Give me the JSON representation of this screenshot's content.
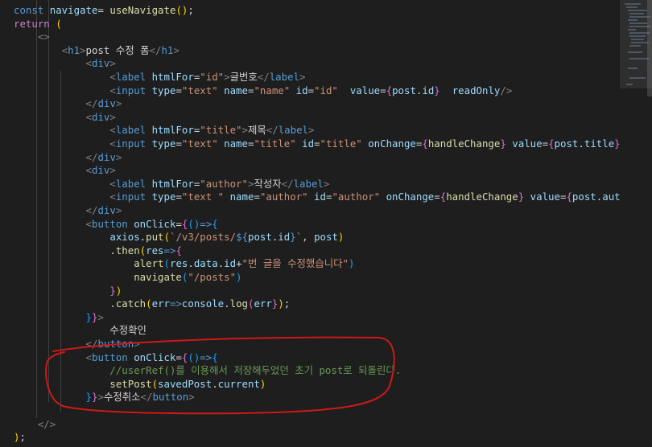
{
  "editor": {
    "language": "jsx",
    "lines": [
      [
        [
          "kw",
          "const "
        ],
        [
          "var",
          "navigate"
        ],
        [
          "pun",
          "= "
        ],
        [
          "fn",
          "useNavigate"
        ],
        [
          "br1",
          "()"
        ],
        [
          "pun",
          ";"
        ]
      ],
      [
        [
          "ctl",
          "return "
        ],
        [
          "br1",
          "("
        ]
      ],
      [
        [
          "pun",
          "    "
        ],
        [
          "ang",
          "<>"
        ]
      ],
      [
        [
          "pun",
          "        "
        ],
        [
          "ang",
          "<"
        ],
        [
          "tag",
          "h1"
        ],
        [
          "ang",
          ">"
        ],
        [
          "txt",
          "post 수정 폼"
        ],
        [
          "ang",
          "</"
        ],
        [
          "tag",
          "h1"
        ],
        [
          "ang",
          ">"
        ]
      ],
      [
        [
          "pun",
          "            "
        ],
        [
          "ang",
          "<"
        ],
        [
          "tag",
          "div"
        ],
        [
          "ang",
          ">"
        ]
      ],
      [
        [
          "pun",
          "                "
        ],
        [
          "ang",
          "<"
        ],
        [
          "tag",
          "label "
        ],
        [
          "attr",
          "htmlFor"
        ],
        [
          "pun",
          "="
        ],
        [
          "str",
          "\"id\""
        ],
        [
          "ang",
          ">"
        ],
        [
          "txt",
          "글번호"
        ],
        [
          "ang",
          "</"
        ],
        [
          "tag",
          "label"
        ],
        [
          "ang",
          ">"
        ]
      ],
      [
        [
          "pun",
          "                "
        ],
        [
          "ang",
          "<"
        ],
        [
          "tag",
          "input "
        ],
        [
          "attr",
          "type"
        ],
        [
          "pun",
          "="
        ],
        [
          "str",
          "\"text\" "
        ],
        [
          "attr",
          "name"
        ],
        [
          "pun",
          "="
        ],
        [
          "str",
          "\"name\" "
        ],
        [
          "attr",
          "id"
        ],
        [
          "pun",
          "="
        ],
        [
          "str",
          "\"id\"  "
        ],
        [
          "attr",
          "value"
        ],
        [
          "pun",
          "="
        ],
        [
          "br2",
          "{"
        ],
        [
          "var",
          "post"
        ],
        [
          "pun",
          "."
        ],
        [
          "var",
          "id"
        ],
        [
          "br2",
          "}"
        ],
        [
          "pun",
          "  "
        ],
        [
          "attr",
          "readOnly"
        ],
        [
          "ang",
          "/>"
        ]
      ],
      [
        [
          "pun",
          "            "
        ],
        [
          "ang",
          "</"
        ],
        [
          "tag",
          "div"
        ],
        [
          "ang",
          ">"
        ]
      ],
      [
        [
          "pun",
          "            "
        ],
        [
          "ang",
          "<"
        ],
        [
          "tag",
          "div"
        ],
        [
          "ang",
          ">"
        ]
      ],
      [
        [
          "pun",
          "                "
        ],
        [
          "ang",
          "<"
        ],
        [
          "tag",
          "label "
        ],
        [
          "attr",
          "htmlFor"
        ],
        [
          "pun",
          "="
        ],
        [
          "str",
          "\"title\""
        ],
        [
          "ang",
          ">"
        ],
        [
          "txt",
          "제목"
        ],
        [
          "ang",
          "</"
        ],
        [
          "tag",
          "label"
        ],
        [
          "ang",
          ">"
        ]
      ],
      [
        [
          "pun",
          "                "
        ],
        [
          "ang",
          "<"
        ],
        [
          "tag",
          "input "
        ],
        [
          "attr",
          "type"
        ],
        [
          "pun",
          "="
        ],
        [
          "str",
          "\"text\" "
        ],
        [
          "attr",
          "name"
        ],
        [
          "pun",
          "="
        ],
        [
          "str",
          "\"title\" "
        ],
        [
          "attr",
          "id"
        ],
        [
          "pun",
          "="
        ],
        [
          "str",
          "\"title\" "
        ],
        [
          "attr",
          "onChange"
        ],
        [
          "pun",
          "="
        ],
        [
          "br2",
          "{"
        ],
        [
          "fn",
          "handleChange"
        ],
        [
          "br2",
          "}"
        ],
        [
          "pun",
          " "
        ],
        [
          "attr",
          "value"
        ],
        [
          "pun",
          "="
        ],
        [
          "br2",
          "{"
        ],
        [
          "var",
          "post"
        ],
        [
          "pun",
          "."
        ],
        [
          "var",
          "title"
        ],
        [
          "br2",
          "}"
        ],
        [
          "ang",
          "/>"
        ]
      ],
      [
        [
          "pun",
          "            "
        ],
        [
          "ang",
          "</"
        ],
        [
          "tag",
          "div"
        ],
        [
          "ang",
          ">"
        ]
      ],
      [
        [
          "pun",
          "            "
        ],
        [
          "ang",
          "<"
        ],
        [
          "tag",
          "div"
        ],
        [
          "ang",
          ">"
        ]
      ],
      [
        [
          "pun",
          "                "
        ],
        [
          "ang",
          "<"
        ],
        [
          "tag",
          "label "
        ],
        [
          "attr",
          "htmlFor"
        ],
        [
          "pun",
          "="
        ],
        [
          "str",
          "\"author\""
        ],
        [
          "ang",
          ">"
        ],
        [
          "txt",
          "작성자"
        ],
        [
          "ang",
          "</"
        ],
        [
          "tag",
          "label"
        ],
        [
          "ang",
          ">"
        ]
      ],
      [
        [
          "pun",
          "                "
        ],
        [
          "ang",
          "<"
        ],
        [
          "tag",
          "input "
        ],
        [
          "attr",
          "type"
        ],
        [
          "pun",
          "="
        ],
        [
          "str",
          "\"text \" "
        ],
        [
          "attr",
          "name"
        ],
        [
          "pun",
          "="
        ],
        [
          "str",
          "\"author\" "
        ],
        [
          "attr",
          "id"
        ],
        [
          "pun",
          "="
        ],
        [
          "str",
          "\"author\" "
        ],
        [
          "attr",
          "onChange"
        ],
        [
          "pun",
          "="
        ],
        [
          "br2",
          "{"
        ],
        [
          "fn",
          "handleChange"
        ],
        [
          "br2",
          "}"
        ],
        [
          "pun",
          " "
        ],
        [
          "attr",
          "value"
        ],
        [
          "pun",
          "="
        ],
        [
          "br2",
          "{"
        ],
        [
          "var",
          "post"
        ],
        [
          "pun",
          "."
        ],
        [
          "var",
          "author"
        ],
        [
          "br2",
          "}"
        ],
        [
          "pun",
          " "
        ],
        [
          "ang",
          "/>"
        ]
      ],
      [
        [
          "pun",
          "            "
        ],
        [
          "ang",
          "</"
        ],
        [
          "tag",
          "div"
        ],
        [
          "ang",
          ">"
        ]
      ],
      [
        [
          "pun",
          "            "
        ],
        [
          "ang",
          "<"
        ],
        [
          "tag",
          "button "
        ],
        [
          "attr",
          "onClick"
        ],
        [
          "pun",
          "="
        ],
        [
          "br2",
          "{"
        ],
        [
          "br3",
          "()"
        ],
        [
          "kw",
          "=>"
        ],
        [
          "br3",
          "{"
        ]
      ],
      [
        [
          "pun",
          "                "
        ],
        [
          "var",
          "axios"
        ],
        [
          "pun",
          "."
        ],
        [
          "fn",
          "put"
        ],
        [
          "br1",
          "("
        ],
        [
          "str",
          "`/v3/posts/"
        ],
        [
          "kw",
          "${"
        ],
        [
          "var",
          "post"
        ],
        [
          "pun",
          "."
        ],
        [
          "var",
          "id"
        ],
        [
          "kw",
          "}"
        ],
        [
          "str",
          "`"
        ],
        [
          "pun",
          ", "
        ],
        [
          "var",
          "post"
        ],
        [
          "br1",
          ")"
        ]
      ],
      [
        [
          "pun",
          "                "
        ],
        [
          "pun",
          "."
        ],
        [
          "fn",
          "then"
        ],
        [
          "br1",
          "("
        ],
        [
          "var",
          "res"
        ],
        [
          "kw",
          "=>"
        ],
        [
          "br2",
          "{"
        ]
      ],
      [
        [
          "pun",
          "                    "
        ],
        [
          "fn",
          "alert"
        ],
        [
          "br3",
          "("
        ],
        [
          "var",
          "res"
        ],
        [
          "pun",
          "."
        ],
        [
          "var",
          "data"
        ],
        [
          "pun",
          "."
        ],
        [
          "var",
          "id"
        ],
        [
          "pun",
          "+"
        ],
        [
          "str",
          "\"번 글을 수정했습니다\""
        ],
        [
          "br3",
          ")"
        ]
      ],
      [
        [
          "pun",
          "                    "
        ],
        [
          "fn",
          "navigate"
        ],
        [
          "br3",
          "("
        ],
        [
          "str",
          "\"/posts\""
        ],
        [
          "br3",
          ")"
        ]
      ],
      [
        [
          "pun",
          "                "
        ],
        [
          "br2",
          "}"
        ],
        [
          "br1",
          ")"
        ]
      ],
      [
        [
          "pun",
          "                "
        ],
        [
          "pun",
          "."
        ],
        [
          "fn",
          "catch"
        ],
        [
          "br1",
          "("
        ],
        [
          "var",
          "err"
        ],
        [
          "kw",
          "=>"
        ],
        [
          "var",
          "console"
        ],
        [
          "pun",
          "."
        ],
        [
          "fn",
          "log"
        ],
        [
          "br2",
          "("
        ],
        [
          "var",
          "err"
        ],
        [
          "br2",
          "}"
        ],
        [
          "br1",
          ")"
        ],
        [
          "pun",
          ";"
        ]
      ],
      [
        [
          "pun",
          "            "
        ],
        [
          "br3",
          "}"
        ],
        [
          "br2",
          "}"
        ],
        [
          "ang",
          ">"
        ]
      ],
      [
        [
          "pun",
          "                "
        ],
        [
          "txt",
          "수정확인"
        ]
      ],
      [
        [
          "pun",
          "            "
        ],
        [
          "ang",
          "</"
        ],
        [
          "tag",
          "button"
        ],
        [
          "ang",
          ">"
        ]
      ],
      [
        [
          "pun",
          "            "
        ],
        [
          "ang",
          "<"
        ],
        [
          "tag",
          "button "
        ],
        [
          "attr",
          "onClick"
        ],
        [
          "pun",
          "="
        ],
        [
          "br2",
          "{"
        ],
        [
          "br3",
          "()"
        ],
        [
          "kw",
          "=>"
        ],
        [
          "br3",
          "{"
        ]
      ],
      [
        [
          "pun",
          "                "
        ],
        [
          "cmt",
          "//userRef()를 이용해서 저장해두었던 초기 post로 되돌린다."
        ]
      ],
      [
        [
          "pun",
          "                "
        ],
        [
          "fn",
          "setPost"
        ],
        [
          "br1",
          "("
        ],
        [
          "var",
          "savedPost"
        ],
        [
          "pun",
          "."
        ],
        [
          "var",
          "current"
        ],
        [
          "br1",
          ")"
        ]
      ],
      [
        [
          "pun",
          "            "
        ],
        [
          "br3",
          "}"
        ],
        [
          "br2",
          "}"
        ],
        [
          "ang",
          ">"
        ],
        [
          "txt",
          "수정취소"
        ],
        [
          "ang",
          "</"
        ],
        [
          "tag",
          "button"
        ],
        [
          "ang",
          ">"
        ]
      ],
      [],
      [
        [
          "pun",
          "    "
        ],
        [
          "ang",
          "</>"
        ]
      ],
      [
        [
          "br1",
          ")"
        ],
        [
          "pun",
          ";"
        ]
      ]
    ]
  },
  "colors": {
    "annotation_circle": "#d01818",
    "background": "#1e1e1e"
  }
}
